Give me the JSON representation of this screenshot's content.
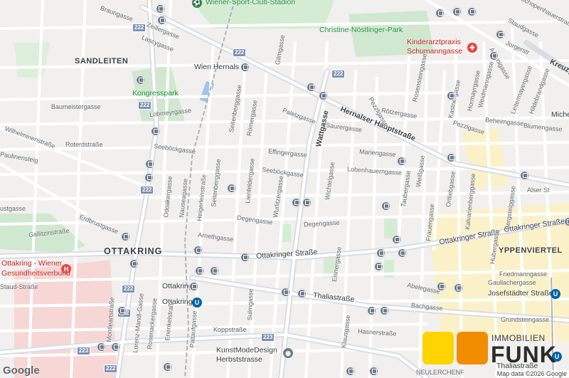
{
  "colors": {
    "land": "#f1f0ee",
    "road": "#ffffff",
    "major_road": "#d9dde3",
    "park": "#c8e6c9",
    "hospital_area": "#f6d7d5",
    "yellow_area": "#fbf1c9",
    "rail": "#b0b4b8",
    "transit": "#6d7b8a",
    "route_shield": "#7b8fb5",
    "poi_green": "#1e8e3e",
    "poi_red": "#c5221f"
  },
  "districts": [
    "SANDLEITEN",
    "OTTAKRING",
    "YPPENVIERTEL"
  ],
  "pois": {
    "sport_club": "Wiener-Sport-Club-Stadion",
    "park_christine": "Christine-Nöstlinger-Park",
    "kinderarzt_1": "Kinderarztpraxis",
    "kinderarzt_2": "Schumanngasse",
    "kongresspark": "Kongresspark",
    "wien_hernals": "Wien Hernals",
    "ottakring_station_1": "Ottakring",
    "ottakring_station_2": "Ottakring",
    "hospital_1": "Ottakring - Wiener",
    "hospital_2": "Gesundheitsverbund",
    "kunstmode_1": "KunstModeDesign",
    "kunstmode_2": "Herbststrasse",
    "michel": "Michel",
    "thalia_station": "Thaliastraße",
    "josefstaedter_station": "Josefstädter Straße"
  },
  "streets": {
    "braungasse": "Braungasse",
    "zeillergasse": "Zeillergasse",
    "lascygasse": "Lascygasse",
    "baumeistergasse": "Baumeistergasse",
    "lobmeyrgasse": "Lobmeyrgasse",
    "wilhelminenstrasse": "Wilhelminenstraße",
    "roterdstrasse": "Roterdstraße",
    "paulinensteig": "Paulinensteig",
    "seeboeckgasse_1": "Seeböckgasse",
    "seeboeckgasse_2": "Seeböckgasse",
    "gilmgasse": "Gilmgasse",
    "seitenberggasse_1": "Seitenberggasse",
    "seitenberggasse_2": "Seitenberggasse",
    "roemergasse": "Römergasse",
    "palletzgasse": "Paletzgasse",
    "effingergasse": "Effingergasse",
    "lienfeldergasse": "Lienfeldergasse",
    "wattgasse": "Wattgasse",
    "saurergasse": "Saurergasse",
    "hernalser_hauptstrasse": "Hernalser Hauptstraße",
    "mariengasse": "Mariengasse",
    "lobenhauerngasse": "Lobenhauerngasse",
    "wichtelgasse": "Wichtelgasse",
    "wurlitzergasse": "Wurlitzergasse",
    "degengasse_1": "Degengasse",
    "degengasse_2": "Degengasse",
    "odoakergasse": "Odoakergasse",
    "nauseagasse": "Nauseagasse",
    "heigerleinstrasse": "Heigerleinstraße",
    "arnethgasse": "Arnethgasse",
    "erdbrustgasse": "Erdbrustgasse",
    "gallitzinstrasse": "Gallitzinstraße",
    "ottakringer_strasse_1": "Ottakringer Straße",
    "ottakringer_strasse_2": "Ottakringer Straße",
    "ottakringer_strasse_3": "Ottakringer Straße",
    "thaliastrasse": "Thaliastraße",
    "sulmgasse": "Sulmgasse",
    "koppstrasse": "Koppstraße",
    "montleartstrasse": "Montleartstraße",
    "lorenz_mandl_gasse": "Lorenz-Mandl-Gasse",
    "rosenackergasse": "Rosenackergasse",
    "enenkelstrasse": "Enenkelstraße",
    "paltaufgasse": "Paltaufgasse",
    "eisnergasse": "Eisnergasse",
    "klausgasse": "Klausgasse",
    "hasnerstrasse": "Hasnerstraße",
    "bachgasse": "Bachgasse",
    "abelegasse": "Abelegasse",
    "friedmanngasse": "Friedmanngasse",
    "gaullachergasse": "Gaullachergasse",
    "grundsteingasse": "Grundsteingasse",
    "huberstrasse": "Hubergasse",
    "kalvarienberggasse": "Kalvarienberggasse",
    "bergsteiggasse": "Bergsteiggasse",
    "ortliebgasse": "Ortliebgasse",
    "frauengasse": "Frauengasse",
    "weissgasse": "Weißgasse",
    "taubergasse": "Taubergasse",
    "beheimgasse": "Beheimgasse",
    "blumengasse": "Blumengasse",
    "pezzlgasse_1": "Pezzlgasse",
    "pezzlgasse_2": "Pezzlgasse",
    "roetzergasse": "Rötzergasse",
    "rosensteingasse": "Rosensteingasse",
    "kastnergasse": "Kastnergasse",
    "hormayrgasse": "Hormayrgasse",
    "weidmanngasse": "Weidmanngasse",
    "leitermayergasse": "Leitermayergasse",
    "hildebrandgasse": "Hildebrandgasse",
    "antonigasse": "Antonigasse",
    "jorgerstrasse": "Jorgerstr",
    "schopenhauerstrasse": "Schopenhauerstraße",
    "staudgasse": "Staudgasse",
    "kreuzgasse": "Kreuzg",
    "alser_strasse": "Alser St",
    "stadt_partial": "Staud-Straße",
    "neulerchenfelder_partial": "NEULERCHENF"
  },
  "route_shields": [
    "222",
    "222",
    "222",
    "222",
    "222",
    "222",
    "222",
    "223",
    "223",
    "222"
  ],
  "legal": {
    "google_label": "Google",
    "map_data": "Map data ©2026 Google"
  },
  "brand": {
    "line1": "IMMOBILIEN",
    "line2": "FUNK",
    "yellow": "#ffd400",
    "orange": "#f28c00"
  }
}
